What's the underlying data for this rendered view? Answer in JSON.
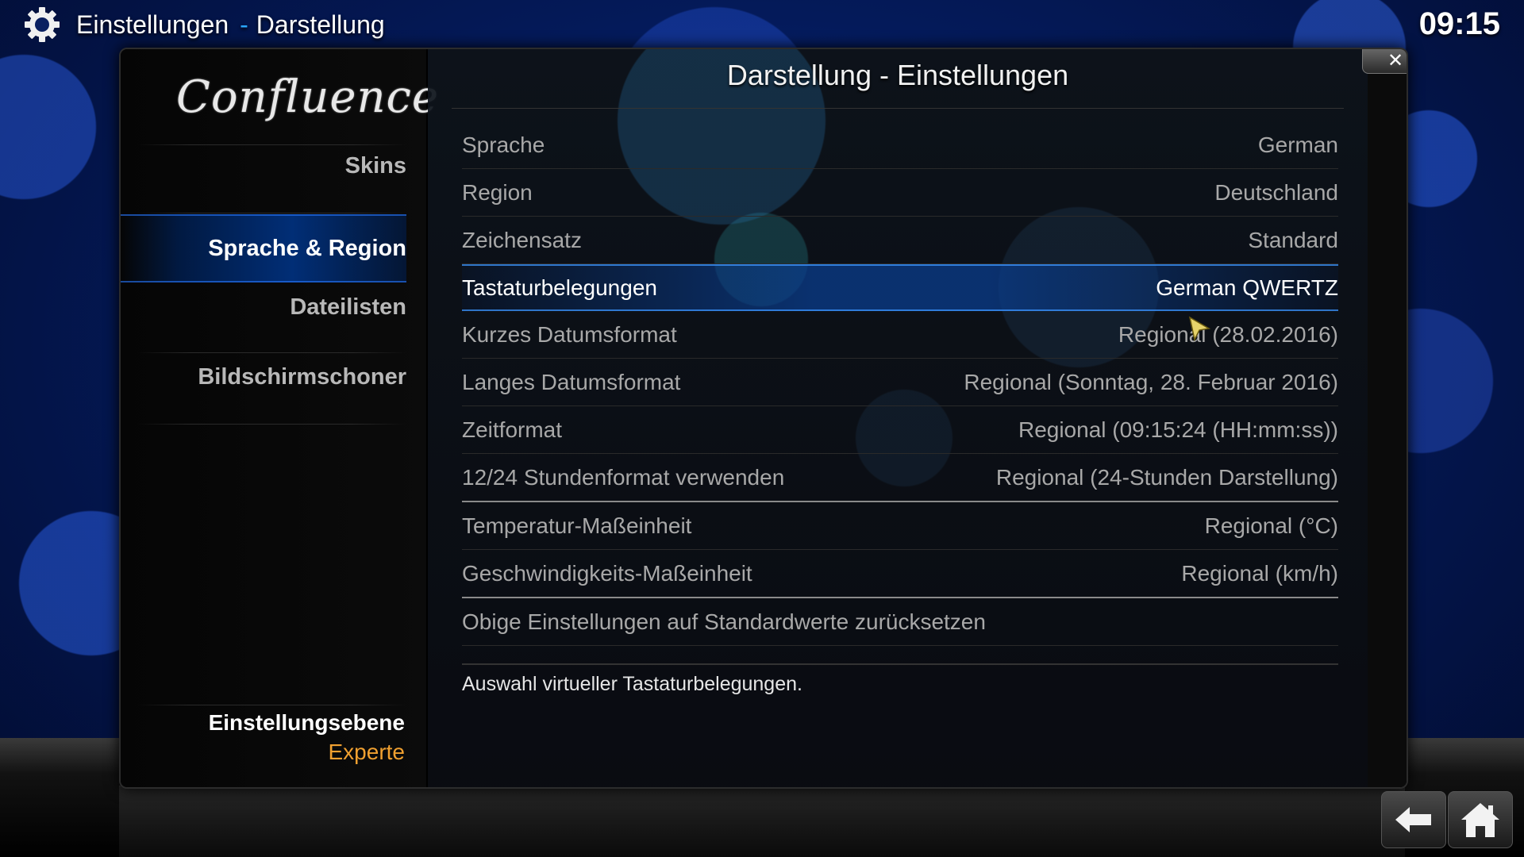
{
  "header": {
    "section": "Einstellungen",
    "separator": "-",
    "page": "Darstellung",
    "clock": "09:15"
  },
  "sidebar": {
    "logo_text": "Confluence",
    "items": [
      {
        "label": "Skins"
      },
      {
        "label": "Sprache & Region"
      },
      {
        "label": "Dateilisten"
      },
      {
        "label": "Bildschirmschoner"
      }
    ],
    "active_index": 1,
    "level_label": "Einstellungsebene",
    "level_value": "Experte"
  },
  "dialog": {
    "title": "Darstellung - Einstellungen",
    "close_symbol": "✕",
    "rows": [
      {
        "label": "Sprache",
        "value": "German"
      },
      {
        "label": "Region",
        "value": "Deutschland"
      },
      {
        "label": "Zeichensatz",
        "value": "Standard"
      },
      {
        "label": "Tastaturbelegungen",
        "value": "German QWERTZ"
      },
      {
        "label": "Kurzes Datumsformat",
        "value": "Regional (28.02.2016)"
      },
      {
        "label": "Langes Datumsformat",
        "value": "Regional (Sonntag, 28. Februar 2016)"
      },
      {
        "label": "Zeitformat",
        "value": "Regional (09:15:24 (HH:mm:ss))"
      },
      {
        "label": "12/24 Stundenformat verwenden",
        "value": "Regional (24-Stunden Darstellung)"
      },
      {
        "label": "Temperatur-Maßeinheit",
        "value": "Regional (°C)"
      },
      {
        "label": "Geschwindigkeits-Maßeinheit",
        "value": "Regional (km/h)"
      },
      {
        "label": "Obige Einstellungen auf Standardwerte zurücksetzen",
        "value": ""
      }
    ],
    "focused_index": 3,
    "description": "Auswahl virtueller Tastaturbelegungen."
  },
  "nav": {
    "back_icon": "back-arrow-icon",
    "home_icon": "home-icon"
  },
  "colors": {
    "accent_blue": "#2aa6ff",
    "level_orange": "#f0a030",
    "focus_blue": "#0a3c8c"
  }
}
